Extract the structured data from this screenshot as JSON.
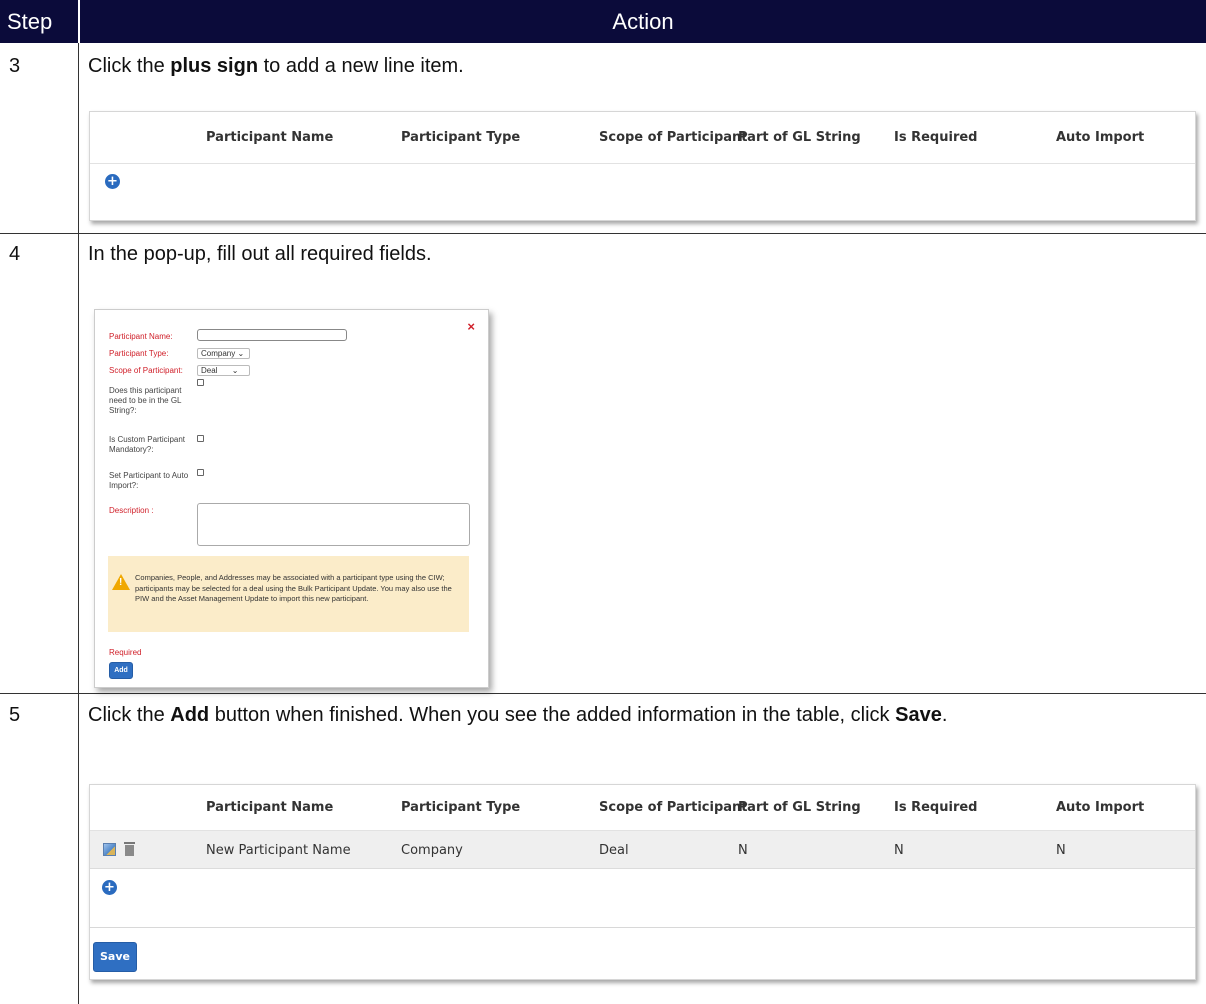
{
  "table": {
    "header_step": "Step",
    "header_action": "Action"
  },
  "rows": [
    {
      "step": "3",
      "text_pre": "Click the ",
      "text_bold": "plus sign",
      "text_post": " to add a new line item."
    },
    {
      "step": "4",
      "text": "In the pop-up, fill out all required fields."
    },
    {
      "step": "5",
      "text_pre": "Click the ",
      "text_bold1": "Add",
      "text_mid": " button when finished. When you see the added information in the table, click ",
      "text_bold2": "Save",
      "text_post": "."
    }
  ],
  "grid": {
    "columns": [
      "Participant Name",
      "Participant Type",
      "Scope of Participant",
      "Part of GL String",
      "Is Required",
      "Auto Import"
    ],
    "added_row": [
      "New Participant Name",
      "Company",
      "Deal",
      "N",
      "N",
      "N"
    ],
    "save_label": "Save"
  },
  "modal": {
    "name_label": "Participant Name:",
    "type_label": "Participant Type:",
    "type_value": "Company",
    "scope_label": "Scope of Participant:",
    "scope_value": "Deal",
    "gl_label": "Does this participant need to be in the GL String?:",
    "custom_label": "Is Custom Participant Mandatory?:",
    "auto_label": "Set Participant to Auto Import?:",
    "desc_label": "Description :",
    "warning": "Companies, People, and Addresses may be associated with a participant type using the CIW; participants may be selected for a deal using the Bulk Participant Update. You may also use the PIW and the Asset Management Update to import this new participant.",
    "required_label": "Required",
    "add_label": "Add",
    "close_glyph": "×"
  },
  "icons": {
    "plus": "plus-circle-icon",
    "edit": "edit-icon",
    "trash": "trash-icon",
    "warning": "warning-icon",
    "close": "close-icon",
    "chevron": "chevron-down-icon"
  },
  "colors": {
    "header_bg": "#0b0b3a",
    "accent_blue": "#2f6fc2",
    "required_red": "#d0202a",
    "warning_bg": "#fbecc9"
  }
}
